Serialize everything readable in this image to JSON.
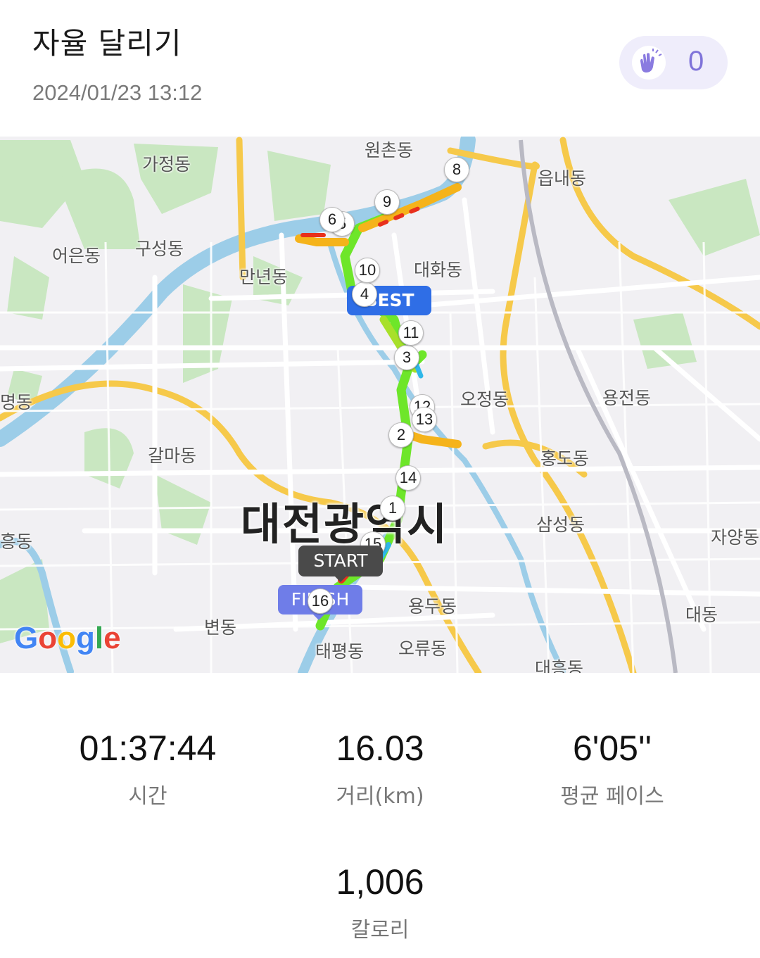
{
  "header": {
    "title": "자율 달리기",
    "datetime": "2024/01/23 13:12",
    "clap_count": "0"
  },
  "map": {
    "city_label": "대전광역시",
    "places": [
      "원촌동",
      "가정동",
      "읍내동",
      "구성동",
      "어은동",
      "만년동",
      "대화동",
      "오정동",
      "용전동",
      "명동",
      "갈마동",
      "홍도동",
      "삼성동",
      "자양동",
      "흥동",
      "용두동",
      "대동",
      "변동",
      "태평동",
      "오류동",
      "대흥동"
    ],
    "km_markers": [
      "1",
      "2",
      "3",
      "4",
      "5",
      "6",
      "8",
      "9",
      "10",
      "11",
      "12",
      "13",
      "14",
      "15",
      "16"
    ],
    "best_label": "BEST",
    "start_label": "START",
    "finish_label": "FINISH",
    "attribution": "Google",
    "route_colors": {
      "slow": "#e8301c",
      "mid": "#f5b31a",
      "fast": "#6ee62a",
      "fastest": "#2fb7e8"
    }
  },
  "stats": {
    "time": {
      "value": "01:37:44",
      "label": "시간"
    },
    "distance": {
      "value": "16.03",
      "label": "거리(km)"
    },
    "pace": {
      "value": "6'05''",
      "label": "평균 페이스"
    },
    "calories": {
      "value": "1,006",
      "label": "칼로리"
    }
  }
}
